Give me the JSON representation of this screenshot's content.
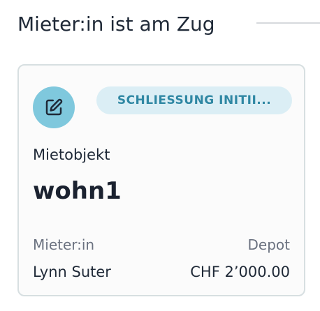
{
  "section": {
    "title": "Mieter:in ist am Zug"
  },
  "card": {
    "status_badge": "SCHLIESSUNG INITII...",
    "object_label": "Mietobjekt",
    "object_name": "wohn1",
    "tenant_label": "Mieter:in",
    "tenant_value": "Lynn Suter",
    "depot_label": "Depot",
    "depot_value": "CHF 2’000.00",
    "icon": "edit-icon",
    "colors": {
      "avatar_bg": "#7fc8dd",
      "badge_bg": "#dbeef5",
      "badge_text": "#2f87a3"
    }
  }
}
